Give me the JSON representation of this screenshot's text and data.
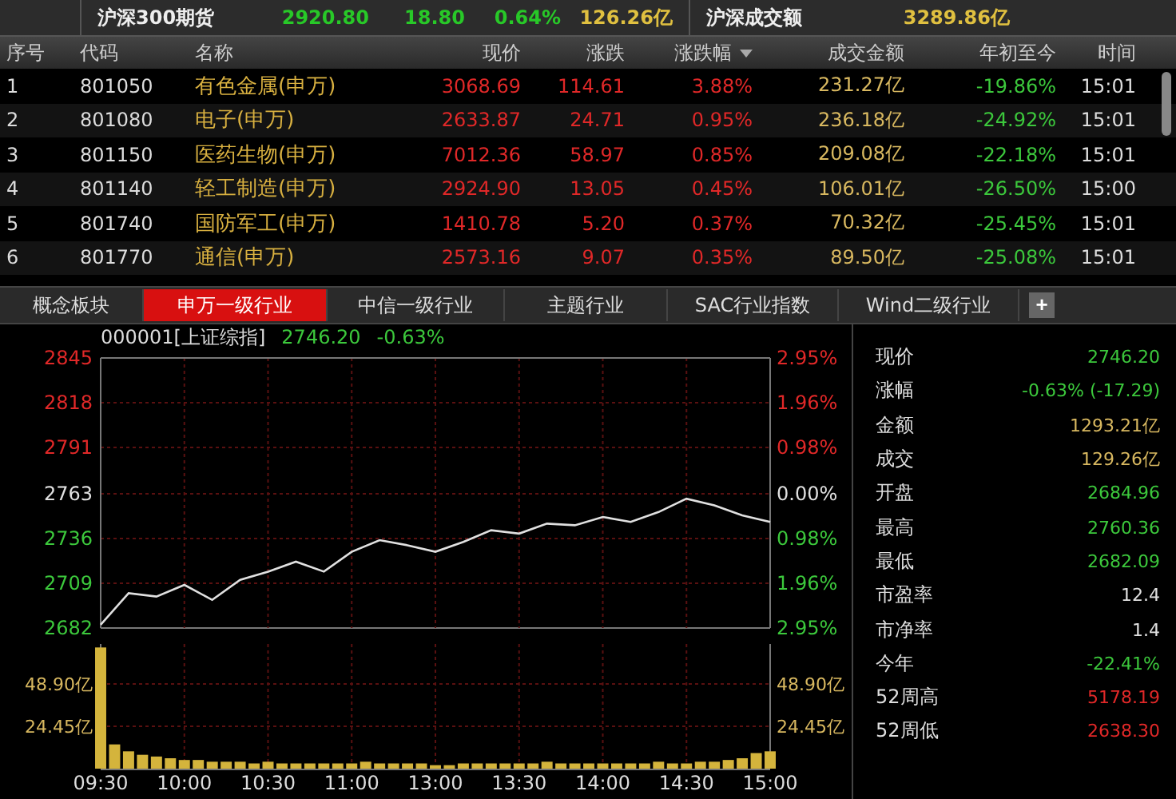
{
  "top_bar": {
    "futures_label": "沪深300期货",
    "futures_values": [
      "2920.80",
      "18.80",
      "0.64%"
    ],
    "futures_amount": "126.26亿",
    "turnover_label": "沪深成交额",
    "turnover_value": "3289.86亿"
  },
  "table": {
    "columns": [
      {
        "label": "序号",
        "sorted": false
      },
      {
        "label": "代码",
        "sorted": false
      },
      {
        "label": "名称",
        "sorted": false
      },
      {
        "label": "现价",
        "sorted": false
      },
      {
        "label": "涨跌",
        "sorted": false
      },
      {
        "label": "涨跌幅",
        "sorted": true
      },
      {
        "label": "成交金额",
        "sorted": false
      },
      {
        "label": "年初至今",
        "sorted": false
      },
      {
        "label": "时间",
        "sorted": false
      }
    ],
    "rows": [
      {
        "cells": [
          "1",
          "801050",
          "有色金属(申万)",
          "3068.69",
          "114.61",
          "3.88%",
          "231.27亿",
          "-19.86%",
          "15:01"
        ]
      },
      {
        "cells": [
          "2",
          "801080",
          "电子(申万)",
          "2633.87",
          "24.71",
          "0.95%",
          "236.18亿",
          "-24.92%",
          "15:01"
        ]
      },
      {
        "cells": [
          "3",
          "801150",
          "医药生物(申万)",
          "7012.36",
          "58.97",
          "0.85%",
          "209.08亿",
          "-22.18%",
          "15:01"
        ]
      },
      {
        "cells": [
          "4",
          "801140",
          "轻工制造(申万)",
          "2924.90",
          "13.05",
          "0.45%",
          "106.01亿",
          "-26.50%",
          "15:00"
        ]
      },
      {
        "cells": [
          "5",
          "801740",
          "国防军工(申万)",
          "1410.78",
          "5.20",
          "0.37%",
          "70.32亿",
          "-25.45%",
          "15:01"
        ]
      },
      {
        "cells": [
          "6",
          "801770",
          "通信(申万)",
          "2573.16",
          "9.07",
          "0.35%",
          "89.50亿",
          "-25.08%",
          "15:01"
        ]
      }
    ]
  },
  "tabs": [
    {
      "label": "概念板块",
      "kind": "tab",
      "selected": false
    },
    {
      "label": "申万一级行业",
      "kind": "tab",
      "selected": true
    },
    {
      "label": "中信一级行业",
      "kind": "tab",
      "selected": false
    },
    {
      "label": "主题行业",
      "kind": "tab",
      "selected": false
    },
    {
      "label": "SAC行业指数",
      "kind": "tab",
      "selected": false
    },
    {
      "label": "Wind二级行业",
      "kind": "tab",
      "selected": false
    },
    {
      "label": "+",
      "kind": "add",
      "selected": false
    }
  ],
  "chart_panel": {
    "header": {
      "code": "000001[上证综指]",
      "price": "2746.20",
      "change": "-0.63%"
    },
    "price_chart": {
      "chart_data": {
        "type": "line",
        "grid": true,
        "ylim": [
          2682,
          2845
        ],
        "yticks": [
          {
            "value": 2845,
            "label": "2845"
          },
          {
            "value": 2818,
            "label": "2818"
          },
          {
            "value": 2791,
            "label": "2791"
          },
          {
            "value": 2763,
            "label": "2763"
          },
          {
            "value": 2736,
            "label": "2736"
          },
          {
            "value": 2709,
            "label": "2709"
          },
          {
            "value": 2682,
            "label": "2682"
          }
        ],
        "series": [
          {
            "color": "#e0e0e0",
            "values": [
              2684,
              2703,
              2701,
              2708,
              2699,
              2711,
              2716,
              2722,
              2716,
              2728,
              2735,
              2732,
              2728,
              2734,
              2741,
              2739,
              2745,
              2744,
              2749,
              2746,
              2752,
              2760,
              2756,
              2750,
              2746
            ]
          }
        ]
      },
      "percent_labels": [
        "2.95%",
        "1.96%",
        "0.98%",
        "0.00%",
        "0.98%",
        "1.96%",
        "2.95%"
      ]
    },
    "volume_chart": {
      "chart_data": {
        "type": "bar",
        "grid": true,
        "ylim": [
          0,
          72
        ],
        "categories": [
          "09:30",
          null,
          null,
          null,
          null,
          null,
          "10:00",
          null,
          null,
          null,
          null,
          null,
          "10:30",
          null,
          null,
          null,
          null,
          null,
          "11:00",
          null,
          null,
          null,
          null,
          null,
          "13:00",
          null,
          null,
          null,
          null,
          null,
          "13:30",
          null,
          null,
          null,
          null,
          null,
          "14:00",
          null,
          null,
          null,
          null,
          null,
          "14:30",
          null,
          null,
          null,
          null,
          null,
          "15:00"
        ],
        "yticks": [
          {
            "value": 24.45,
            "label": "24.45亿"
          },
          {
            "value": 48.9,
            "label": "48.90亿"
          }
        ],
        "series": [
          {
            "color": "#d4b43c",
            "values": [
              70,
              14,
              10,
              8,
              7,
              6,
              5,
              5,
              4,
              4,
              4,
              3,
              4,
              3,
              3,
              3,
              3,
              3,
              3,
              4,
              3,
              3,
              3,
              3,
              2,
              2,
              3,
              3,
              3,
              3,
              3,
              3,
              4,
              3,
              3,
              3,
              3,
              3,
              3,
              3,
              4,
              3,
              3,
              4,
              4,
              5,
              6,
              9,
              10
            ]
          }
        ]
      },
      "right_labels": [
        "48.90亿",
        "24.45亿"
      ]
    }
  },
  "quote_panel": {
    "rows": [
      {
        "label": "现价",
        "value": "2746.20",
        "color": "#3cc83c"
      },
      {
        "label": "涨幅",
        "value": "-0.63% (-17.29)",
        "color": "#3cc83c"
      },
      {
        "label": "金额",
        "value": "1293.21亿",
        "color": "#d8b860"
      },
      {
        "label": "成交",
        "value": "129.26亿",
        "color": "#d8b860"
      },
      {
        "label": "开盘",
        "value": "2684.96",
        "color": "#3cc83c"
      },
      {
        "label": "最高",
        "value": "2760.36",
        "color": "#3cc83c"
      },
      {
        "label": "最低",
        "value": "2682.09",
        "color": "#3cc83c"
      },
      {
        "label": "市盈率",
        "value": "12.4",
        "color": "#e0e0e0"
      },
      {
        "label": "市净率",
        "value": "1.4",
        "color": "#e0e0e0"
      },
      {
        "label": "今年",
        "value": "-22.41%",
        "color": "#3cc83c"
      },
      {
        "label": "52周高",
        "value": "5178.19",
        "color": "#e02828"
      },
      {
        "label": "52周低",
        "value": "2638.30",
        "color": "#e02828"
      }
    ]
  }
}
